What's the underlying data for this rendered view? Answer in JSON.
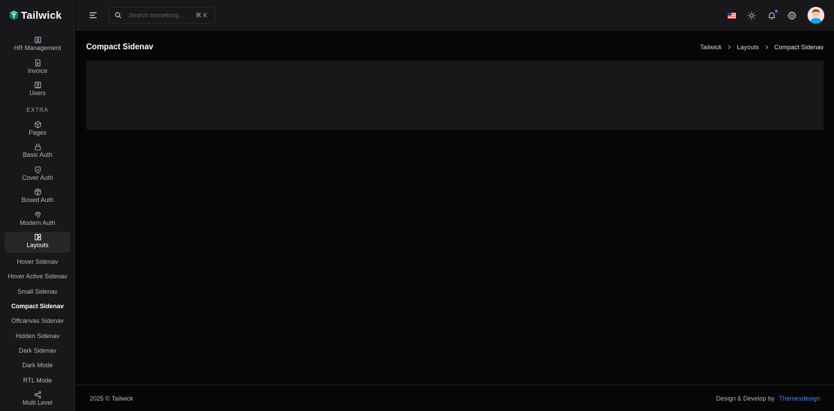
{
  "app": {
    "brand": "Tailwick",
    "brand_color": "#14b8a6",
    "accent": "#3b82f6"
  },
  "sidebar": {
    "items_top": [
      {
        "label": "HR Management",
        "icon": "clipboard-user-icon"
      },
      {
        "label": "Invoice",
        "icon": "file-text-icon"
      },
      {
        "label": "Users",
        "icon": "user-square-icon"
      }
    ],
    "section_extra": "EXTRA",
    "items_extra": [
      {
        "label": "Pages",
        "icon": "box-icon"
      },
      {
        "label": "Basic Auth",
        "icon": "lock-icon"
      },
      {
        "label": "Cover Auth",
        "icon": "shield-check-icon"
      },
      {
        "label": "Boxed Auth",
        "icon": "package-icon"
      },
      {
        "label": "Modern Auth",
        "icon": "fingerprint-icon"
      },
      {
        "label": "Layouts",
        "icon": "layout-icon"
      }
    ],
    "layouts_sub": [
      "Hover Sidenav",
      "Hover Active Sidenav",
      "Small Sidenav",
      "Compact Sidenav",
      "Offcanvas Sidenav",
      "Hidden Sidenav",
      "Dark Sidenav",
      "Dark Mode",
      "RTL Mode"
    ],
    "multi_level": {
      "label": "Multi Level",
      "icon": "share-icon"
    }
  },
  "topbar": {
    "search": {
      "placeholder": "Search something...",
      "shortcut": "⌘ K"
    }
  },
  "page": {
    "title": "Compact Sidenav",
    "breadcrumb": [
      "Tailwick",
      "Layouts",
      "Compact Sidenav"
    ]
  },
  "footer": {
    "copyright": "2025 © Tailwick",
    "credit_prefix": "Design & Develop by",
    "credit_link": "Themesdesign"
  }
}
